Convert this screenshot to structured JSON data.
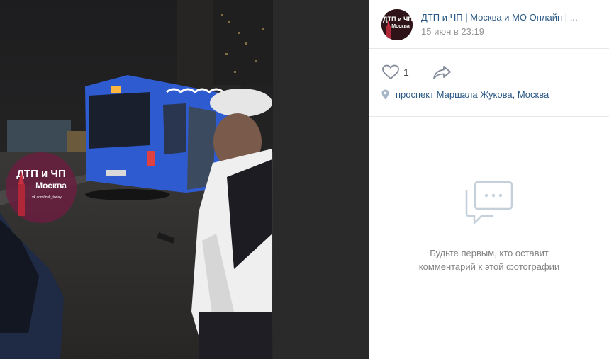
{
  "post": {
    "author": "ДТП и ЧП | Москва и МО Онлайн | ...",
    "date": "15 июн в 23:19",
    "likes": "1",
    "location": "проспект Маршала Жукова, Москва"
  },
  "watermark": {
    "line1": "ДТП и ЧП",
    "line2": "Москва",
    "line3": "vk.com/msk_today"
  },
  "avatar_text": {
    "line1": "ДТП и ЧП",
    "line2": "Москва"
  },
  "comments": {
    "empty_line1": "Будьте первым, кто оставит",
    "empty_line2": "комментарий к этой фотографии"
  },
  "colors": {
    "link": "#2a5885",
    "muted": "#939393",
    "icon": "#828a99",
    "bus": "#2f5bd0"
  },
  "icons": [
    "heart-icon",
    "share-icon",
    "location-pin-icon",
    "comments-icon"
  ]
}
